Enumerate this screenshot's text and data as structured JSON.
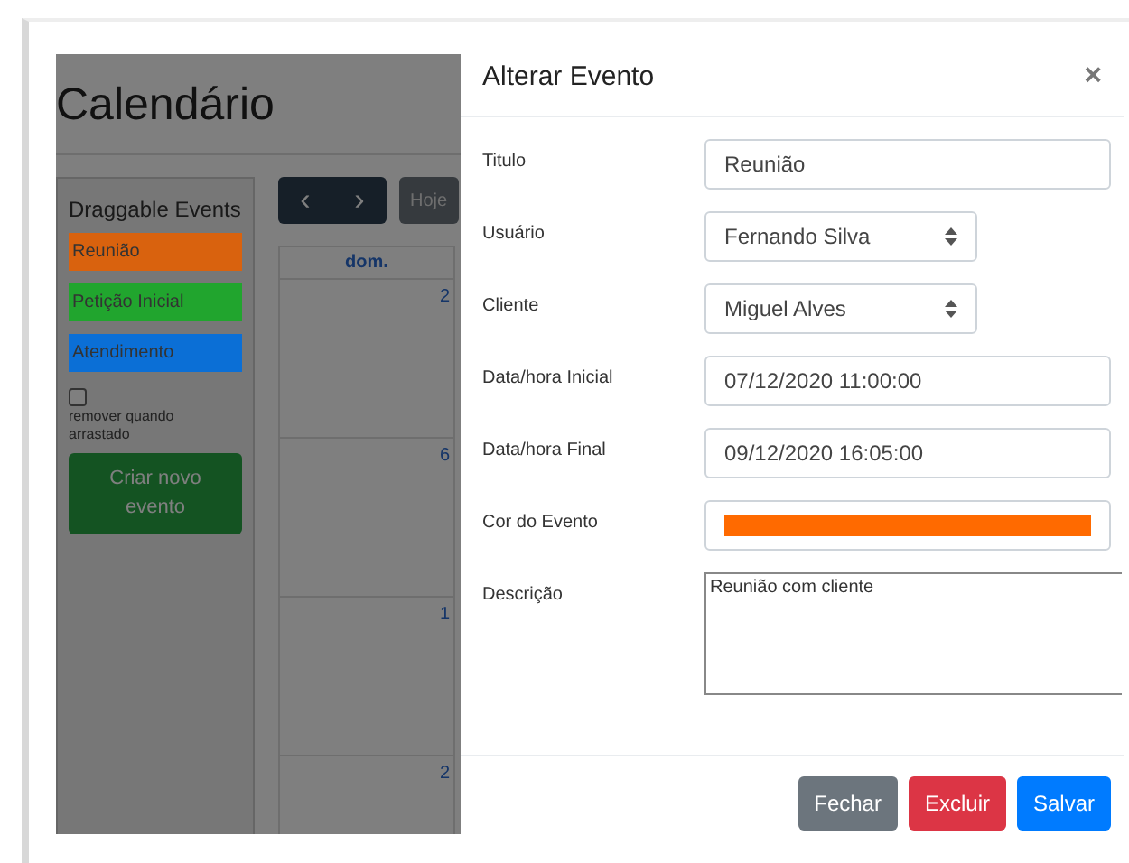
{
  "calendar": {
    "title": "Calendário",
    "sidebar": {
      "heading": "Draggable Events",
      "events": [
        {
          "label": "Reunião",
          "color": "#d9620e"
        },
        {
          "label": "Petição Inicial",
          "color": "#21a52e"
        },
        {
          "label": "Atendimento",
          "color": "#0b6fd6"
        }
      ],
      "remove_on_drag": {
        "label": "remover quando arrastado",
        "checked": false
      },
      "create_button": "Criar novo evento"
    },
    "nav": {
      "prev": "‹",
      "next": "›",
      "today": "Hoje"
    },
    "column_header": "dom.",
    "day_numbers": [
      "2",
      "6",
      "1",
      "2"
    ]
  },
  "modal": {
    "title": "Alterar Evento",
    "close": "×",
    "fields": [
      {
        "kind": "text",
        "label": "Titulo",
        "value": "Reunião"
      },
      {
        "kind": "select",
        "label": "Usuário",
        "value": "Fernando Silva"
      },
      {
        "kind": "select",
        "label": "Cliente",
        "value": "Miguel Alves"
      },
      {
        "kind": "text",
        "label": "Data/hora Inicial",
        "value": "07/12/2020 11:00:00"
      },
      {
        "kind": "text",
        "label": "Data/hora Final",
        "value": "09/12/2020 16:05:00"
      },
      {
        "kind": "color",
        "label": "Cor do Evento",
        "color": "#ff6a00"
      },
      {
        "kind": "textarea",
        "label": "Descrição",
        "value": "Reunião com cliente"
      }
    ],
    "buttons": [
      {
        "label": "Fechar",
        "kind": "secondary"
      },
      {
        "label": "Excluir",
        "kind": "danger"
      },
      {
        "label": "Salvar",
        "kind": "primary"
      }
    ]
  }
}
